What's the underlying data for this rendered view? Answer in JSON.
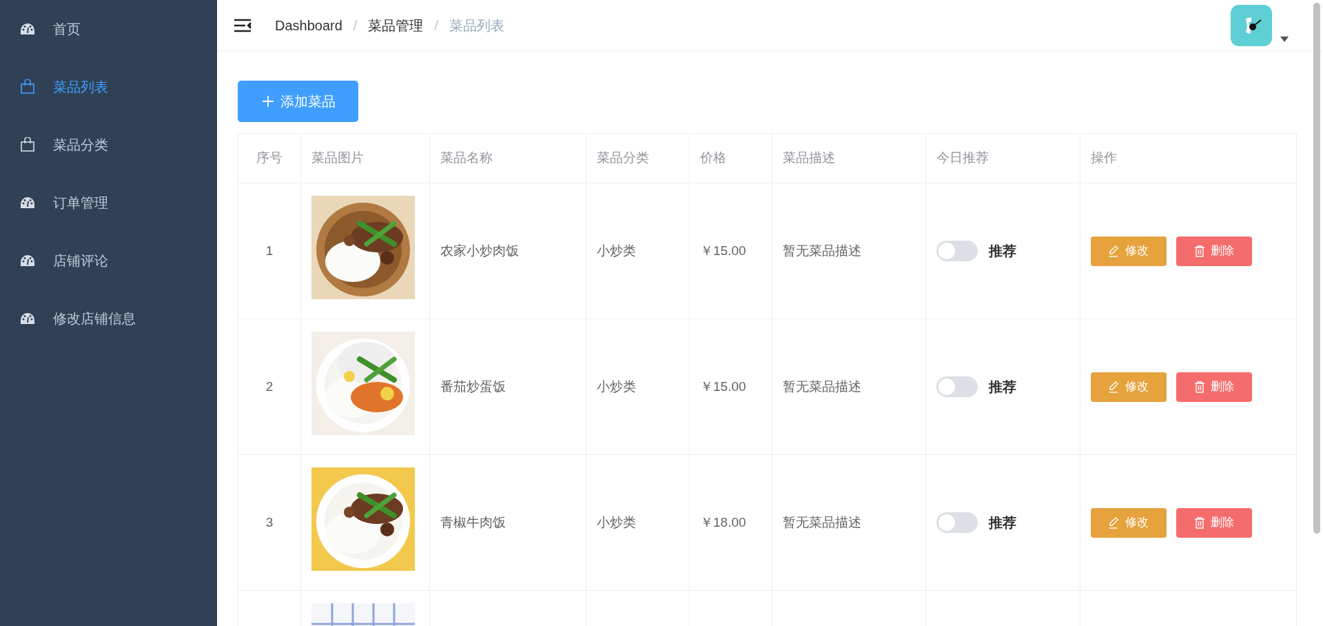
{
  "sidebar": {
    "items": [
      {
        "label": "首页",
        "kind": "gauge",
        "selected": false
      },
      {
        "label": "菜品列表",
        "kind": "bag",
        "selected": true
      },
      {
        "label": "菜品分类",
        "kind": "bag",
        "selected": false
      },
      {
        "label": "订单管理",
        "kind": "gauge",
        "selected": false
      },
      {
        "label": "店铺评论",
        "kind": "gauge",
        "selected": false
      },
      {
        "label": "修改店铺信息",
        "kind": "gauge",
        "selected": false
      }
    ]
  },
  "breadcrumb": {
    "separator": "/",
    "items": [
      "Dashboard",
      "菜品管理",
      "菜品列表"
    ]
  },
  "add_button": "添加菜品",
  "table": {
    "columns": [
      "序号",
      "菜品图片",
      "菜品名称",
      "菜品分类",
      "价格",
      "菜品描述",
      "今日推荐",
      "操作"
    ],
    "rows": [
      {
        "index": "1",
        "image": {
          "kind": "picture"
        },
        "name": "农家小炒肉饭",
        "category": "小炒类",
        "price": "￥15.00",
        "description": "暂无菜品描述",
        "recommended": false,
        "switch_label": "推荐",
        "edit": "修改",
        "delete": "删除"
      },
      {
        "index": "2",
        "image": {
          "kind": "picture"
        },
        "name": "番茄炒蛋饭",
        "category": "小炒类",
        "price": "￥15.00",
        "description": "暂无菜品描述",
        "recommended": false,
        "switch_label": "推荐",
        "edit": "修改",
        "delete": "删除"
      },
      {
        "index": "3",
        "image": {
          "kind": "picture"
        },
        "name": "青椒牛肉饭",
        "category": "小炒类",
        "price": "￥18.00",
        "description": "暂无菜品描述",
        "recommended": false,
        "switch_label": "推荐",
        "edit": "修改",
        "delete": "删除"
      },
      {
        "image": {
          "kind": "picture"
        }
      }
    ]
  }
}
